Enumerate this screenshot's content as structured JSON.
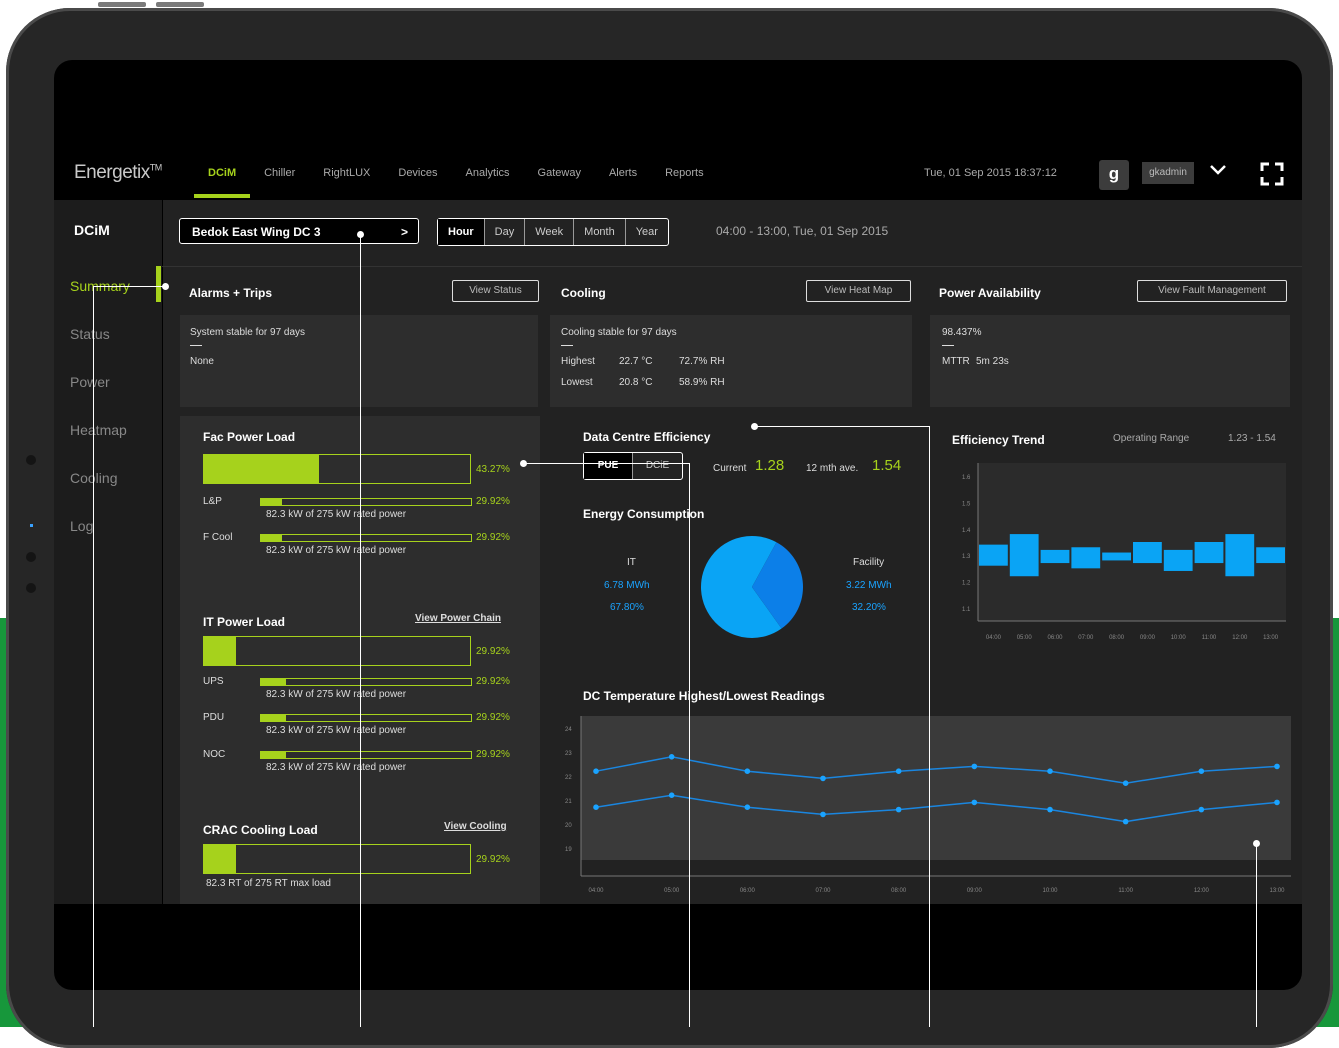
{
  "brand": "Energetix",
  "brand_tm": "TM",
  "nav": [
    "DCiM",
    "Chiller",
    "RightLUX",
    "Devices",
    "Analytics",
    "Gateway",
    "Alerts",
    "Reports"
  ],
  "datetime": "Tue, 01 Sep 2015  18:37:12",
  "user": {
    "avatar": "g",
    "name": "gkadmin"
  },
  "sidebar": {
    "title": "DCiM",
    "items": [
      "Summary",
      "Status",
      "Power",
      "Heatmap",
      "Cooling",
      "Log"
    ],
    "active": "Summary"
  },
  "selector": {
    "label": "Bedok East Wing DC 3",
    "arrow": ">"
  },
  "range_tabs": [
    "Hour",
    "Day",
    "Week",
    "Month",
    "Year"
  ],
  "time_range": "04:00 - 13:00, Tue, 01 Sep 2015",
  "alarms": {
    "title": "Alarms + Trips",
    "button": "View Status",
    "status": "System stable for 97 days",
    "value": "None"
  },
  "cooling": {
    "title": "Cooling",
    "button": "View Heat Map",
    "status": "Cooling stable for 97 days",
    "highest_label": "Highest",
    "highest_temp": "22.7 °C",
    "highest_rh": "72.7% RH",
    "lowest_label": "Lowest",
    "lowest_temp": "20.8 °C",
    "lowest_rh": "58.9% RH"
  },
  "power_availability": {
    "title": "Power Availability",
    "button": "View Fault Management",
    "value": "98.437%",
    "mttr_label": "MTTR",
    "mttr_value": "5m 23s"
  },
  "fac_power": {
    "title": "Fac Power  Load",
    "main_pct": "43.27%",
    "main_fill": 0.4327,
    "rows": [
      {
        "label": "L&P",
        "pct": "29.92%",
        "fill": 0.1,
        "detail": "82.3 kW  of 275 kW rated power"
      },
      {
        "label": "F Cool",
        "pct": "29.92%",
        "fill": 0.1,
        "detail": "82.3 kW  of 275 kW rated power"
      }
    ]
  },
  "it_power": {
    "title": "IT Power Load",
    "link": "View Power Chain",
    "main_pct": "29.92%",
    "main_fill": 0.12,
    "rows": [
      {
        "label": "UPS",
        "pct": "29.92%",
        "fill": 0.12,
        "detail": "82.3 kW  of 275 kW rated power"
      },
      {
        "label": "PDU",
        "pct": "29.92%",
        "fill": 0.12,
        "detail": "82.3 kW  of 275 kW rated power"
      },
      {
        "label": "NOC",
        "pct": "29.92%",
        "fill": 0.12,
        "detail": "82.3 kW  of 275 kW rated power"
      }
    ]
  },
  "crac": {
    "title": "CRAC Cooling Load",
    "link": "View Cooling",
    "main_pct": "29.92%",
    "main_fill": 0.12,
    "detail": "82.3 RT  of 275 RT max load"
  },
  "efficiency": {
    "title": "Data Centre Efficiency",
    "tabs": [
      "PUE",
      "DCiE"
    ],
    "current_label": "Current",
    "current_value": "1.28",
    "avg_label": "12 mth ave.",
    "avg_value": "1.54"
  },
  "energy": {
    "title": "Energy Consumption",
    "it_label": "IT",
    "it_value": "6.78 MWh",
    "it_pct": "67.80%",
    "facility_label": "Facility",
    "facility_value": "3.22 MWh",
    "facility_pct": "32.20%"
  },
  "trend": {
    "title": "Efficiency Trend",
    "range_label": "Operating Range",
    "range_value": "1.23 - 1.54"
  },
  "colors": {
    "accent": "#a6d21c",
    "blue": "#1aa3ff",
    "panel": "#2d2d2d",
    "background": "#222222"
  },
  "chart_data": [
    {
      "type": "pie",
      "labels": [
        "IT",
        "Facility"
      ],
      "values": [
        67.8,
        32.2
      ]
    },
    {
      "type": "bar",
      "title": "Efficiency Trend",
      "categories": [
        "04:00",
        "05:00",
        "06:00",
        "07:00",
        "08:00",
        "09:00",
        "10:00",
        "11:00",
        "12:00",
        "13:00"
      ],
      "low": [
        1.26,
        1.22,
        1.27,
        1.25,
        1.28,
        1.27,
        1.24,
        1.27,
        1.22,
        1.27
      ],
      "high": [
        1.34,
        1.38,
        1.32,
        1.33,
        1.31,
        1.35,
        1.32,
        1.35,
        1.38,
        1.33
      ],
      "yticks": [
        "1.6",
        "1.5",
        "1.4",
        "1.3",
        "1.2",
        "1.1"
      ],
      "ylim": [
        1.05,
        1.65
      ]
    },
    {
      "type": "line",
      "title": "DC Temperature Highest/Lowest Readings",
      "categories": [
        "04:00",
        "05:00",
        "06:00",
        "07:00",
        "08:00",
        "09:00",
        "10:00",
        "11:00",
        "12:00",
        "13:00"
      ],
      "yticks": [
        "24",
        "23",
        "22",
        "21",
        "20",
        "19"
      ],
      "ylim": [
        18.5,
        24.5
      ],
      "series": [
        {
          "values": [
            22.2,
            22.8,
            22.2,
            21.9,
            22.2,
            22.4,
            22.2,
            21.7,
            22.2,
            22.4
          ]
        },
        {
          "values": [
            20.7,
            21.2,
            20.7,
            20.4,
            20.6,
            20.9,
            20.6,
            20.1,
            20.6,
            20.9
          ]
        }
      ]
    }
  ]
}
